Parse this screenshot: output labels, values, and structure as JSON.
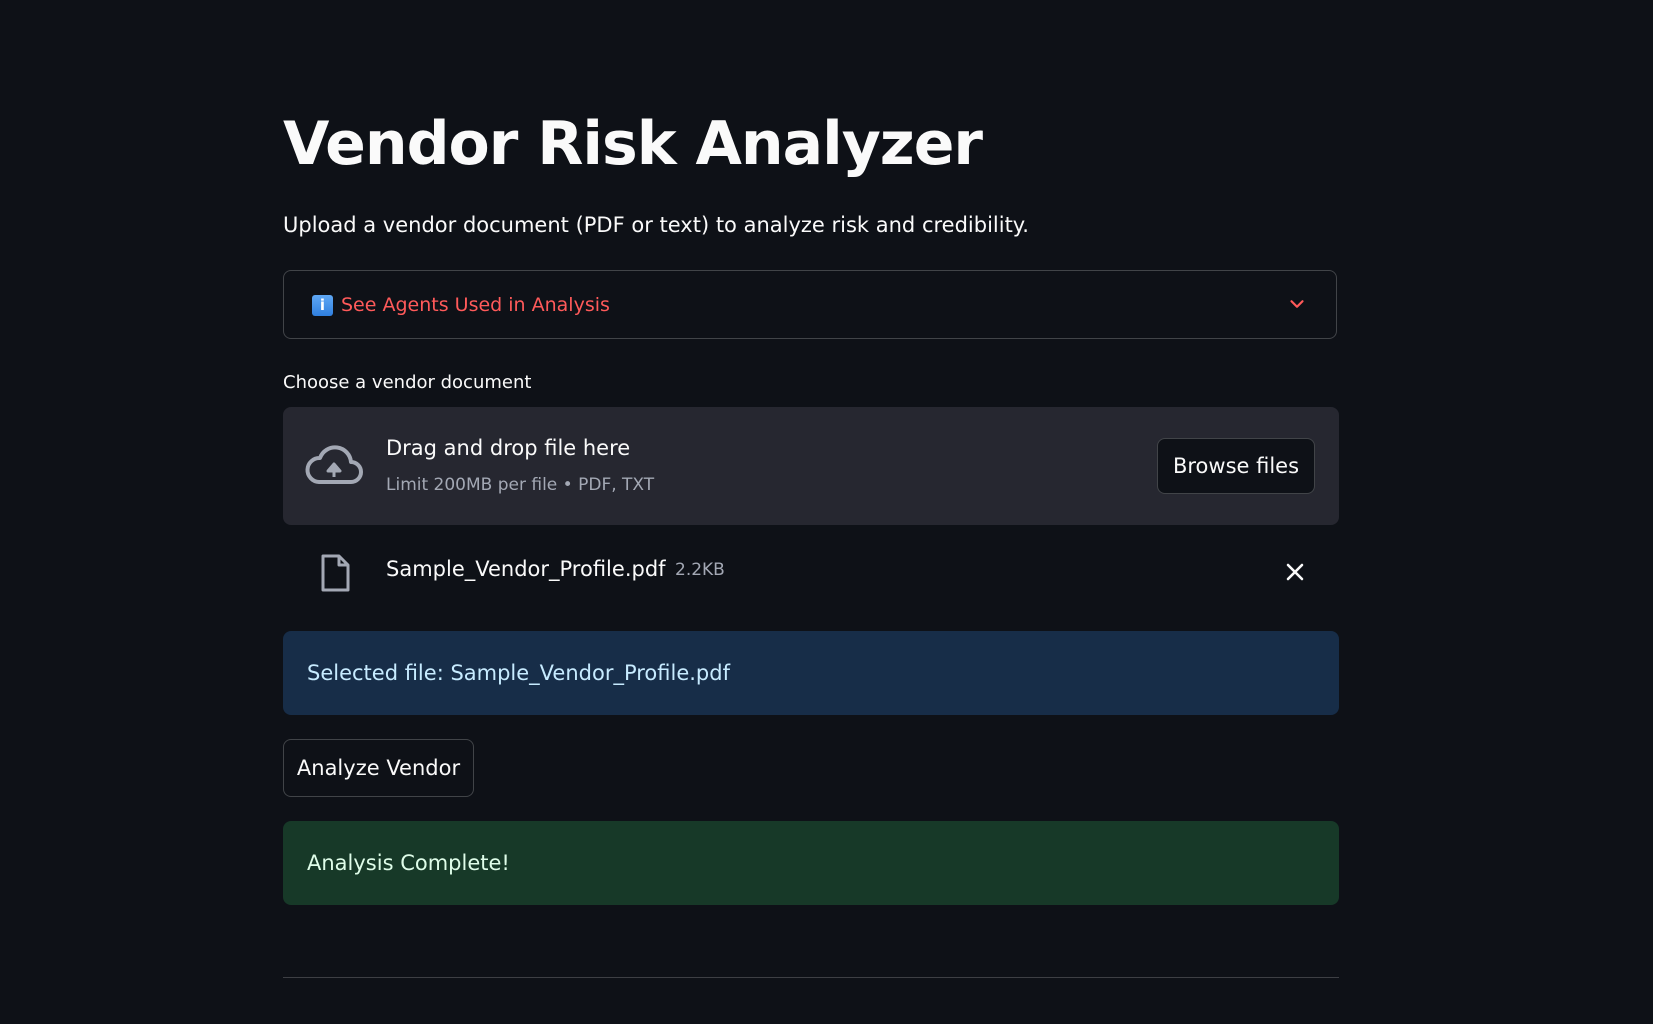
{
  "header": {
    "title": "Vendor Risk Analyzer",
    "subtitle": "Upload a vendor document (PDF or text) to analyze risk and credibility."
  },
  "expander": {
    "icon": "info-icon",
    "icon_glyph": "i",
    "label": "See Agents Used in Analysis",
    "expanded": false
  },
  "uploader": {
    "label": "Choose a vendor document",
    "drop_title": "Drag and drop file here",
    "drop_hint": "Limit 200MB per file • PDF, TXT",
    "browse_label": "Browse files",
    "file": {
      "name": "Sample_Vendor_Profile.pdf",
      "size": "2.2KB"
    }
  },
  "selected_info": "Selected file: Sample_Vendor_Profile.pdf",
  "analyze_label": "Analyze Vendor",
  "success_message": "Analysis Complete!",
  "colors": {
    "background": "#0e1117",
    "accent": "#ff5a5a",
    "info_bg": "#172d48",
    "success_bg": "#173928"
  }
}
